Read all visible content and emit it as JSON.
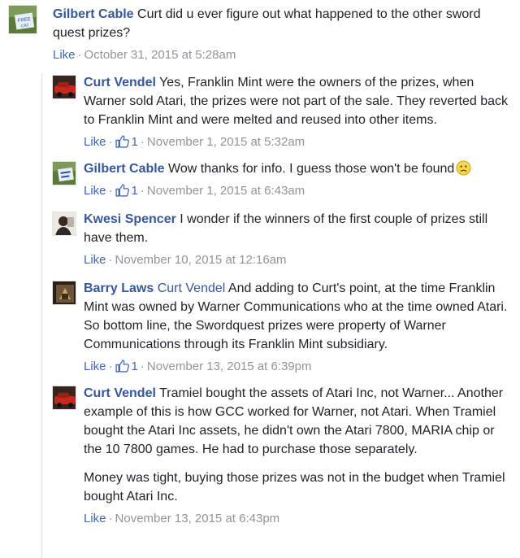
{
  "comments": [
    {
      "author": "Gilbert Cable",
      "text": "Curt did u ever figure out what happened to the other sword quest prizes?",
      "like_label": "Like",
      "timestamp": "October 31, 2015 at 5:28am",
      "avatar_text": "FREE CAT"
    },
    {
      "author": "Curt Vendel",
      "text": "Yes, Franklin Mint were the owners of the prizes, when Warner sold Atari, the prizes were not part of the sale. They reverted back to Franklin Mint and were melted and reused into other items.",
      "like_label": "Like",
      "likes": "1",
      "timestamp": "November 1, 2015 at 5:32am"
    },
    {
      "author": "Gilbert Cable",
      "text": "Wow thanks for info. I guess those won't be found",
      "like_label": "Like",
      "likes": "1",
      "timestamp": "November 1, 2015 at 6:43am"
    },
    {
      "author": "Kwesi Spencer",
      "text": "I wonder if the winners of the first couple of prizes still have them.",
      "like_label": "Like",
      "timestamp": "November 10, 2015 at 12:16am"
    },
    {
      "author": "Barry Laws",
      "mention": "Curt Vendel",
      "text": "And adding to Curt's point, at the time Franklin Mint was owned by Warner Communications who at the time owned Atari. So bottom line, the Swordquest prizes were property of Warner Communications through its Franklin Mint subsidiary.",
      "like_label": "Like",
      "likes": "1",
      "timestamp": "November 13, 2015 at 6:39pm"
    },
    {
      "author": "Curt Vendel",
      "text": "Tramiel bought the assets of Atari Inc, not Warner... Another example of this is how GCC worked for Warner, not Atari. When Tramiel bought the Atari Inc assets, he didn't own the Atari 7800, MARIA chip or the 10 7800 games. He had to purchase those separately.",
      "text2": "Money was tight, buying those prizes was not in the budget when Tramiel bought Atari Inc.",
      "like_label": "Like",
      "timestamp": "November 13, 2015 at 6:43pm"
    }
  ],
  "separator": "·",
  "colors": {
    "link": "#365899",
    "meta": "#90949c",
    "like": "#4267b2"
  }
}
